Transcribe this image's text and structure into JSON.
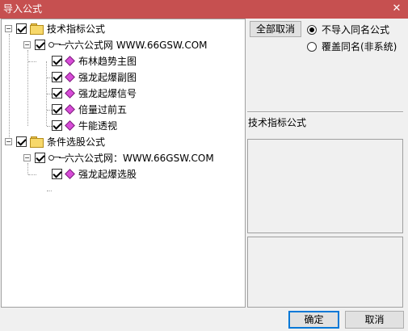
{
  "window": {
    "title": "导入公式",
    "close_glyph": "✕"
  },
  "tree": {
    "groups": [
      {
        "label": "技术指标公式",
        "source": "六六公式网 WWW.66GSW.COM",
        "items": [
          "布林趋势主图",
          "强龙起爆副图",
          "强龙起爆信号",
          "倍量过前五",
          "牛能透视"
        ]
      },
      {
        "label": "条件选股公式",
        "source": "六六公式网：WWW.66GSW.COM",
        "items": [
          "强龙起爆选股"
        ]
      }
    ],
    "expander_minus": "−"
  },
  "options": {
    "cancel_all_label": "全部取消",
    "radio_skip_label": "不导入同名公式",
    "radio_overwrite_label": "覆盖同名(非系统)",
    "selected": "skip"
  },
  "detail": {
    "formula_label": "技术指标公式"
  },
  "footer": {
    "ok_label": "确定",
    "cancel_label": "取消"
  }
}
